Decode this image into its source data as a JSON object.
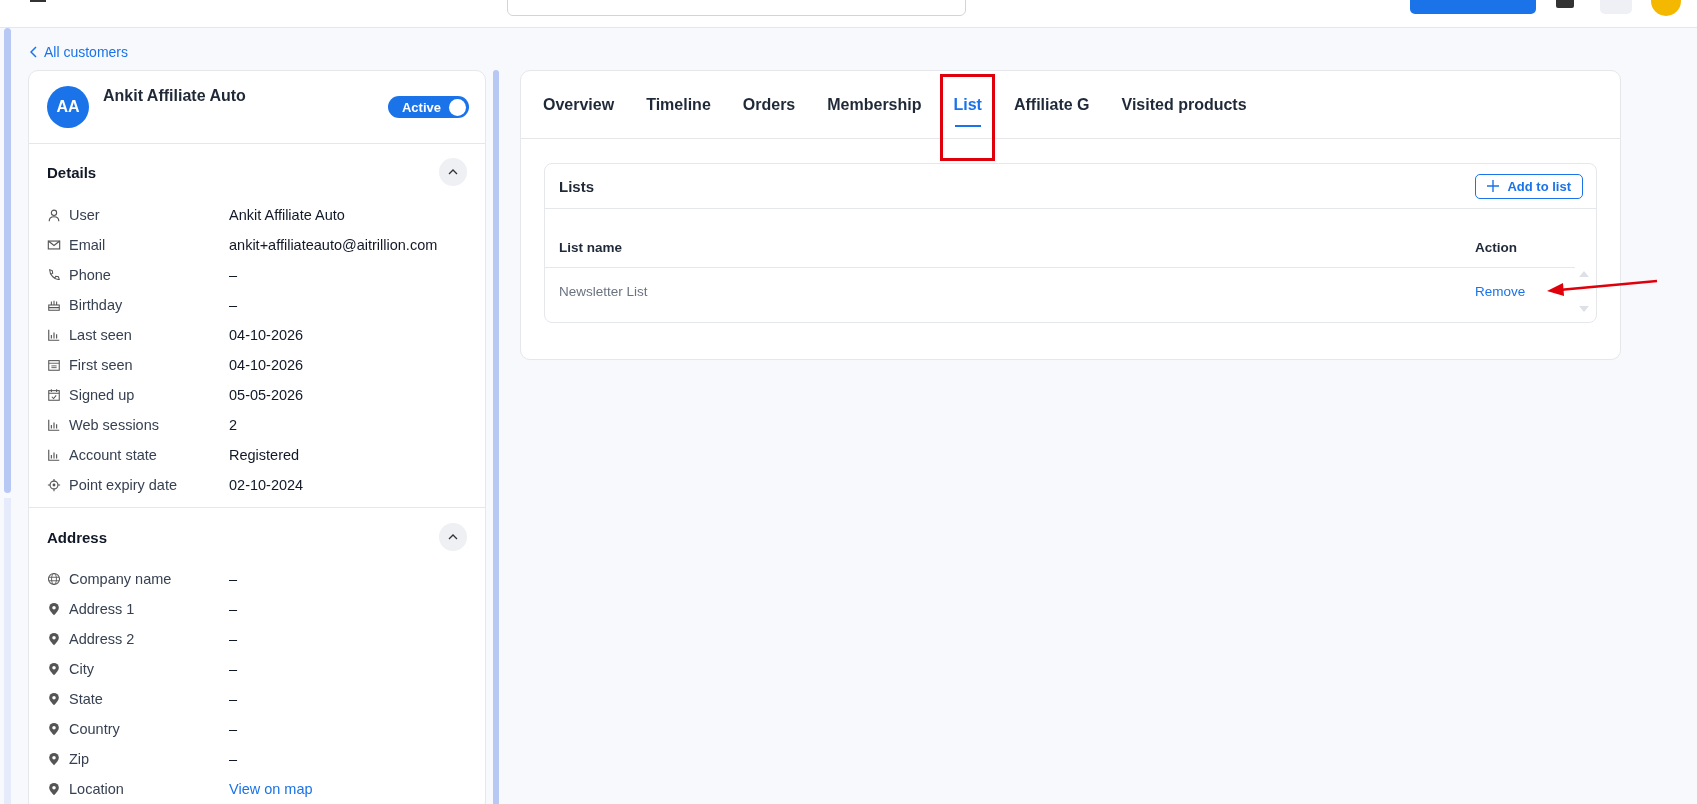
{
  "breadcrumb": {
    "label": "All customers"
  },
  "customer": {
    "initials": "AA",
    "name": "Ankit Affiliate Auto",
    "status": {
      "label": "Active",
      "on": true
    }
  },
  "sections": [
    {
      "title": "Details",
      "expanded": true,
      "rows": [
        {
          "label": "User",
          "value": "Ankit Affiliate Auto",
          "kind": "text"
        },
        {
          "label": "Email",
          "value": "ankit+affiliateauto@aitrillion.com",
          "kind": "text"
        },
        {
          "label": "Phone",
          "value": "–",
          "kind": "text"
        },
        {
          "label": "Birthday",
          "value": "–",
          "kind": "text"
        },
        {
          "label": "Last seen",
          "value": "04-10-2026",
          "kind": "text"
        },
        {
          "label": "First seen",
          "value": "04-10-2026",
          "kind": "text"
        },
        {
          "label": "Signed up",
          "value": "05-05-2026",
          "kind": "text"
        },
        {
          "label": "Web sessions",
          "value": "2",
          "kind": "text"
        },
        {
          "label": "Account state",
          "value": "Registered",
          "kind": "text"
        },
        {
          "label": "Point expiry date",
          "value": "02-10-2024",
          "kind": "text"
        }
      ]
    },
    {
      "title": "Address",
      "expanded": true,
      "rows": [
        {
          "label": "Company name",
          "value": "–",
          "kind": "text"
        },
        {
          "label": "Address 1",
          "value": "–",
          "kind": "text"
        },
        {
          "label": "Address 2",
          "value": "–",
          "kind": "text"
        },
        {
          "label": "City",
          "value": "–",
          "kind": "text"
        },
        {
          "label": "State",
          "value": "–",
          "kind": "text"
        },
        {
          "label": "Country",
          "value": "–",
          "kind": "text"
        },
        {
          "label": "Zip",
          "value": "–",
          "kind": "text"
        },
        {
          "label": "Location",
          "value": "View on map",
          "kind": "link"
        }
      ]
    }
  ],
  "tabs": [
    {
      "label": "Overview",
      "selected": false
    },
    {
      "label": "Timeline",
      "selected": false
    },
    {
      "label": "Orders",
      "selected": false
    },
    {
      "label": "Membership",
      "selected": false
    },
    {
      "label": "List",
      "selected": true
    },
    {
      "label": "Affiliate G",
      "selected": false
    },
    {
      "label": "Visited products",
      "selected": false
    }
  ],
  "lists": {
    "title": "Lists",
    "add_button": "Add to list",
    "columns": [
      "List name",
      "Action"
    ],
    "rows": [
      {
        "name": "Newsletter List",
        "action": "Remove"
      }
    ]
  }
}
